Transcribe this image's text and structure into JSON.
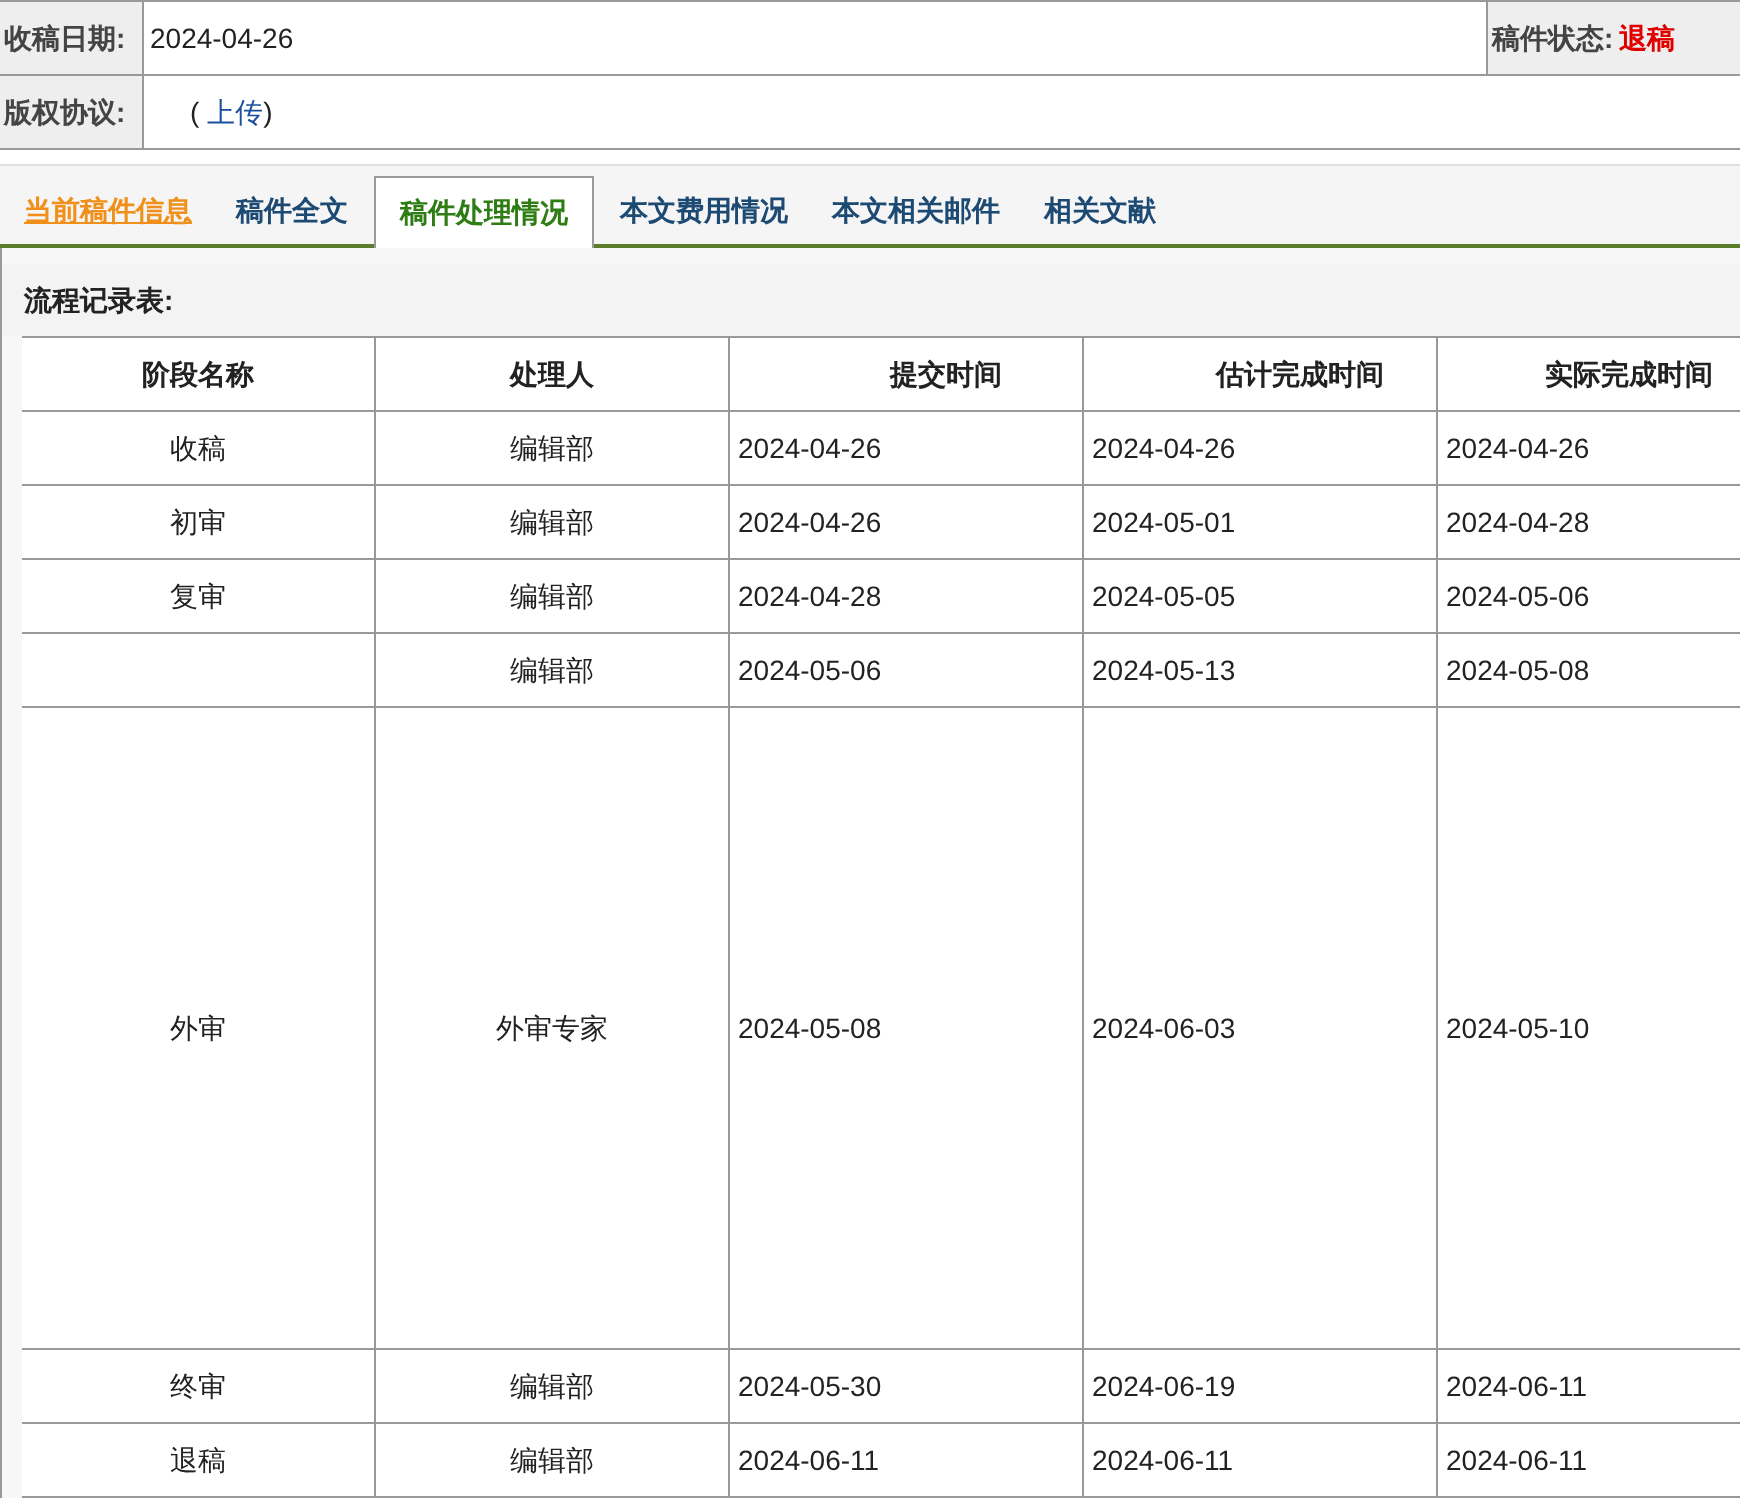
{
  "info": {
    "received_label": "收稿日期:",
    "received_date": "2024-04-26",
    "status_label": "稿件状态:",
    "status_value": "退稿",
    "copyright_label": "版权协议:",
    "copyright_open": "(",
    "copyright_link": "上传",
    "copyright_close": ")"
  },
  "tabs": [
    {
      "label": "当前稿件信息",
      "selected": false,
      "highlighted": true
    },
    {
      "label": "稿件全文",
      "selected": false,
      "highlighted": false
    },
    {
      "label": "稿件处理情况",
      "selected": true,
      "highlighted": false
    },
    {
      "label": "本文费用情况",
      "selected": false,
      "highlighted": false
    },
    {
      "label": "本文相关邮件",
      "selected": false,
      "highlighted": false
    },
    {
      "label": "相关文献",
      "selected": false,
      "highlighted": false
    }
  ],
  "section_title": "流程记录表:",
  "table": {
    "columns": [
      "阶段名称",
      "处理人",
      "提交时间",
      "估计完成时间",
      "实际完成时间"
    ],
    "rows": [
      {
        "kind": "normal",
        "cells": [
          "收稿",
          "编辑部",
          "2024-04-26",
          "2024-04-26",
          "2024-04-26"
        ]
      },
      {
        "kind": "normal",
        "cells": [
          "初审",
          "编辑部",
          "2024-04-26",
          "2024-05-01",
          "2024-04-28"
        ]
      },
      {
        "kind": "normal",
        "cells": [
          "复审",
          "编辑部",
          "2024-04-28",
          "2024-05-05",
          "2024-05-06"
        ]
      },
      {
        "kind": "normal",
        "cells": [
          "",
          "编辑部",
          "2024-05-06",
          "2024-05-13",
          "2024-05-08"
        ]
      },
      {
        "kind": "tall",
        "cells": [
          "外审",
          "外审专家",
          "2024-05-08",
          "2024-06-03",
          "2024-05-10"
        ]
      },
      {
        "kind": "normal",
        "cells": [
          "终审",
          "编辑部",
          "2024-05-30",
          "2024-06-19",
          "2024-06-11"
        ]
      },
      {
        "kind": "normal",
        "cells": [
          "退稿",
          "编辑部",
          "2024-06-11",
          "2024-06-11",
          "2024-06-11"
        ]
      }
    ]
  }
}
